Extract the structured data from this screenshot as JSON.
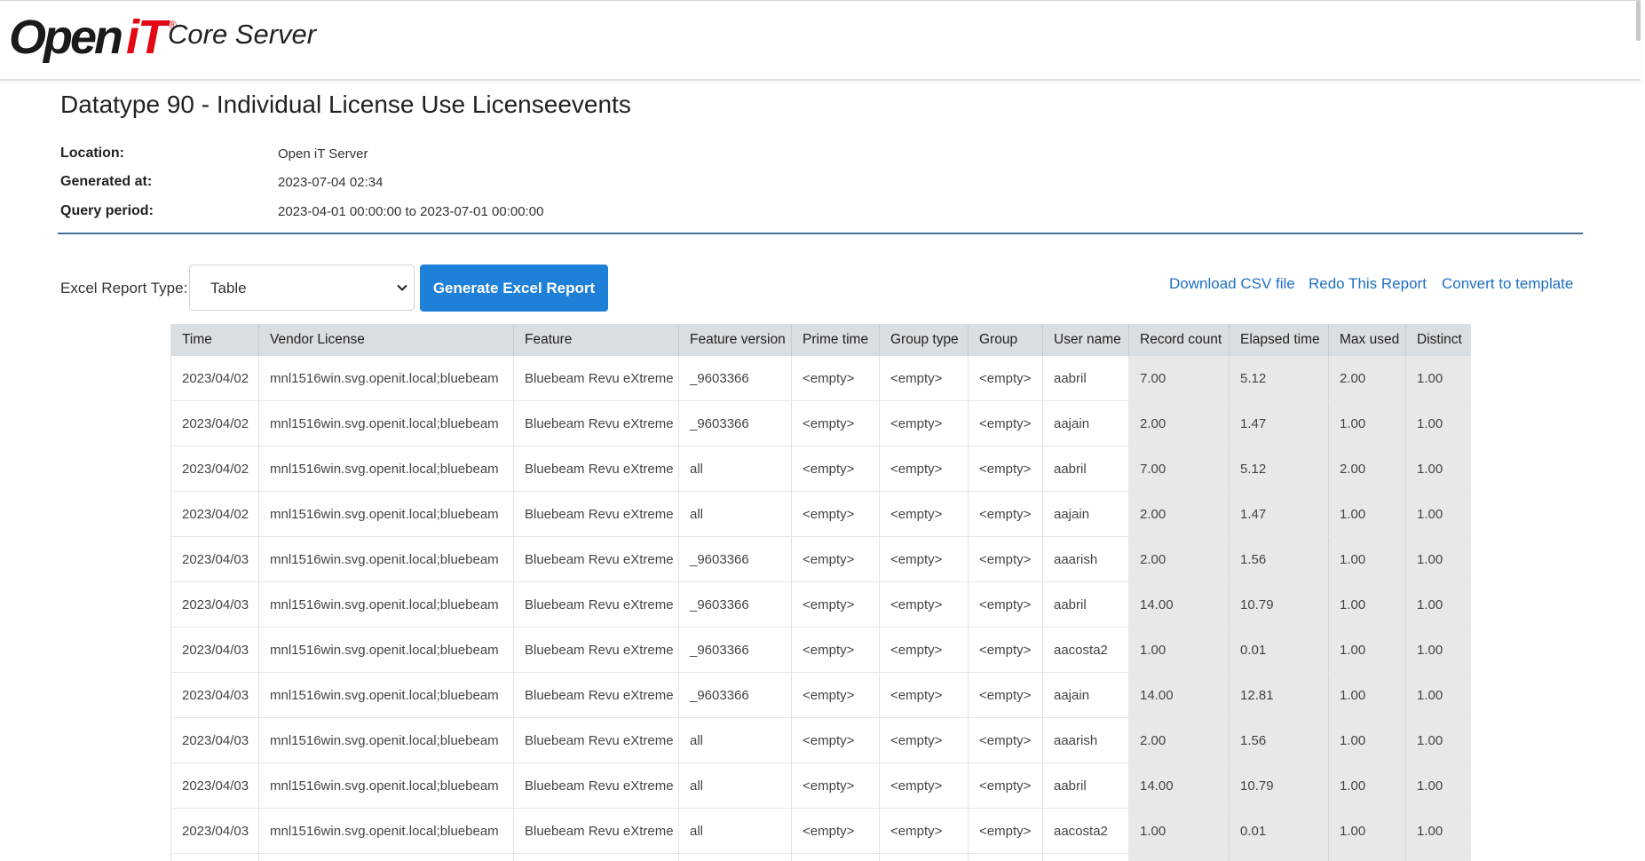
{
  "header": {
    "logo_text_a": "Open",
    "logo_text_b": "iT",
    "logo_reg": "®",
    "product": "Core Server"
  },
  "report": {
    "title": "Datatype 90 - Individual License Use Licenseevents",
    "location_label": "Location:",
    "location": "Open iT Server",
    "generated_label": "Generated at:",
    "generated": "2023-07-04 02:34",
    "period_label": "Query period:",
    "period": "2023-04-01 00:00:00 to 2023-07-01 00:00:00"
  },
  "toolbar": {
    "report_type_label": "Excel Report Type:",
    "report_type_value": "Table",
    "generate_button": "Generate Excel Report",
    "download_csv": "Download CSV file",
    "redo": "Redo This Report",
    "convert": "Convert to template"
  },
  "table": {
    "columns": [
      "Time",
      "Vendor License",
      "Feature",
      "Feature version",
      "Prime time",
      "Group type",
      "Group",
      "User name",
      "Record count",
      "Elapsed time",
      "Max used",
      "Distinct"
    ],
    "rows": [
      [
        "2023/04/02",
        "mnl1516win.svg.openit.local;bluebeam",
        "Bluebeam Revu eXtreme",
        "_9603366",
        "<empty>",
        "<empty>",
        "<empty>",
        "aabril",
        "7.00",
        "5.12",
        "2.00",
        "1.00"
      ],
      [
        "2023/04/02",
        "mnl1516win.svg.openit.local;bluebeam",
        "Bluebeam Revu eXtreme",
        "_9603366",
        "<empty>",
        "<empty>",
        "<empty>",
        "aajain",
        "2.00",
        "1.47",
        "1.00",
        "1.00"
      ],
      [
        "2023/04/02",
        "mnl1516win.svg.openit.local;bluebeam",
        "Bluebeam Revu eXtreme",
        "all",
        "<empty>",
        "<empty>",
        "<empty>",
        "aabril",
        "7.00",
        "5.12",
        "2.00",
        "1.00"
      ],
      [
        "2023/04/02",
        "mnl1516win.svg.openit.local;bluebeam",
        "Bluebeam Revu eXtreme",
        "all",
        "<empty>",
        "<empty>",
        "<empty>",
        "aajain",
        "2.00",
        "1.47",
        "1.00",
        "1.00"
      ],
      [
        "2023/04/03",
        "mnl1516win.svg.openit.local;bluebeam",
        "Bluebeam Revu eXtreme",
        "_9603366",
        "<empty>",
        "<empty>",
        "<empty>",
        "aaarish",
        "2.00",
        "1.56",
        "1.00",
        "1.00"
      ],
      [
        "2023/04/03",
        "mnl1516win.svg.openit.local;bluebeam",
        "Bluebeam Revu eXtreme",
        "_9603366",
        "<empty>",
        "<empty>",
        "<empty>",
        "aabril",
        "14.00",
        "10.79",
        "1.00",
        "1.00"
      ],
      [
        "2023/04/03",
        "mnl1516win.svg.openit.local;bluebeam",
        "Bluebeam Revu eXtreme",
        "_9603366",
        "<empty>",
        "<empty>",
        "<empty>",
        "aacosta2",
        "1.00",
        "0.01",
        "1.00",
        "1.00"
      ],
      [
        "2023/04/03",
        "mnl1516win.svg.openit.local;bluebeam",
        "Bluebeam Revu eXtreme",
        "_9603366",
        "<empty>",
        "<empty>",
        "<empty>",
        "aajain",
        "14.00",
        "12.81",
        "1.00",
        "1.00"
      ],
      [
        "2023/04/03",
        "mnl1516win.svg.openit.local;bluebeam",
        "Bluebeam Revu eXtreme",
        "all",
        "<empty>",
        "<empty>",
        "<empty>",
        "aaarish",
        "2.00",
        "1.56",
        "1.00",
        "1.00"
      ],
      [
        "2023/04/03",
        "mnl1516win.svg.openit.local;bluebeam",
        "Bluebeam Revu eXtreme",
        "all",
        "<empty>",
        "<empty>",
        "<empty>",
        "aabril",
        "14.00",
        "10.79",
        "1.00",
        "1.00"
      ],
      [
        "2023/04/03",
        "mnl1516win.svg.openit.local;bluebeam",
        "Bluebeam Revu eXtreme",
        "all",
        "<empty>",
        "<empty>",
        "<empty>",
        "aacosta2",
        "1.00",
        "0.01",
        "1.00",
        "1.00"
      ],
      [
        "",
        "",
        "",
        "",
        "",
        "",
        "",
        "",
        "",
        "",
        "",
        ""
      ]
    ]
  },
  "colors": {
    "accent": "#1f80d8",
    "link": "#1f6fc2",
    "brand_red": "#e30613",
    "divider": "#4a6f96"
  }
}
